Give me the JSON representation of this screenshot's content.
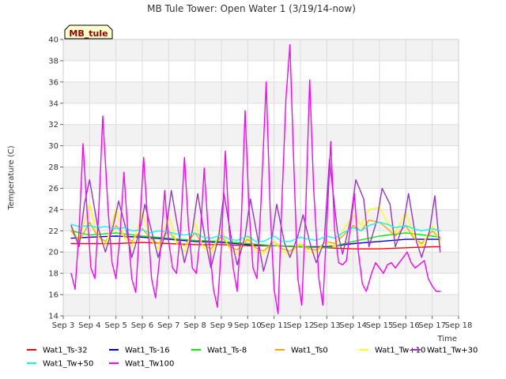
{
  "chart_data": {
    "type": "line",
    "title": "MB Tule Tower: Open Water 1 (3/19/14-now)",
    "badge": "MB_tule",
    "xlabel": "Time",
    "ylabel": "Temperature (C)",
    "xlim": [
      3,
      18
    ],
    "ylim": [
      14,
      40
    ],
    "x_tick_values": [
      3,
      4,
      5,
      6,
      7,
      8,
      9,
      10,
      11,
      12,
      13,
      14,
      15,
      16,
      17,
      18
    ],
    "x_tick_labels": [
      "Sep 3",
      "Sep 4",
      "Sep 5",
      "Sep 6",
      "Sep 7",
      "Sep 8",
      "Sep 9",
      "Sep 10",
      "Sep 11",
      "Sep 12",
      "Sep 13",
      "Sep 14",
      "Sep 15",
      "Sep 16",
      "Sep 17",
      "Sep 18"
    ],
    "y_ticks": [
      14,
      16,
      18,
      20,
      22,
      24,
      26,
      28,
      30,
      32,
      34,
      36,
      38,
      40
    ],
    "grid": true,
    "legend_position": "bottom",
    "series": [
      {
        "name": "Wat1_Ts-32",
        "color": "#ff0000",
        "x": [
          3.3,
          4,
          5,
          6,
          7,
          8,
          9,
          10,
          11,
          12,
          13,
          14,
          15,
          16,
          17,
          17.3
        ],
        "y": [
          20.8,
          20.8,
          20.8,
          20.9,
          20.8,
          20.7,
          20.7,
          20.6,
          20.6,
          20.5,
          20.4,
          20.3,
          20.3,
          20.4,
          20.5,
          20.5
        ]
      },
      {
        "name": "Wat1_Ts-16",
        "color": "#0000cc",
        "x": [
          3.3,
          4,
          5,
          6,
          7,
          8,
          9,
          10,
          11,
          12,
          13,
          14,
          15,
          16,
          17,
          17.3
        ],
        "y": [
          21.3,
          21.4,
          21.5,
          21.4,
          21.2,
          21.0,
          20.9,
          20.7,
          20.6,
          20.5,
          20.5,
          20.8,
          21.0,
          21.2,
          21.2,
          21.2
        ]
      },
      {
        "name": "Wat1_Ts-8",
        "color": "#00ee00",
        "x": [
          3.3,
          4,
          5,
          6,
          7,
          8,
          9,
          10,
          11,
          12,
          13,
          14,
          15,
          16,
          17,
          17.3
        ],
        "y": [
          22.0,
          21.6,
          21.8,
          21.5,
          21.3,
          21.1,
          21.0,
          20.8,
          20.6,
          20.5,
          20.4,
          21.0,
          21.5,
          21.8,
          21.5,
          21.4
        ]
      },
      {
        "name": "Wat1_Ts0",
        "color": "#ffa500",
        "x": [
          3.3,
          3.6,
          4.0,
          4.3,
          4.6,
          5.0,
          5.3,
          5.6,
          6.0,
          6.3,
          6.6,
          7.0,
          7.3,
          7.6,
          8.0,
          8.3,
          8.6,
          9.0,
          9.3,
          9.6,
          10.0,
          10.3,
          10.6,
          11.0,
          11.3,
          11.6,
          12.0,
          12.3,
          12.6,
          13.0,
          13.3,
          13.6,
          14.0,
          14.3,
          14.6,
          15.0,
          15.3,
          15.6,
          16.0,
          16.3,
          16.6,
          17.0,
          17.3
        ],
        "y": [
          22.0,
          21.0,
          22.8,
          21.5,
          21.0,
          22.5,
          21.6,
          21.0,
          22.2,
          21.3,
          20.8,
          22.0,
          21.0,
          20.6,
          21.8,
          20.7,
          20.3,
          21.5,
          20.5,
          20.2,
          21.2,
          20.4,
          20.1,
          21.0,
          20.3,
          20.1,
          20.8,
          20.3,
          20.2,
          21.0,
          20.8,
          21.5,
          22.5,
          22.0,
          23.0,
          22.8,
          22.2,
          21.5,
          22.5,
          21.3,
          20.8,
          22.0,
          21.2
        ]
      },
      {
        "name": "Wat1_Tw+10",
        "color": "#ffff00",
        "x": [
          3.3,
          3.6,
          4.0,
          4.3,
          4.6,
          5.0,
          5.3,
          5.6,
          6.0,
          6.3,
          6.6,
          7.0,
          7.3,
          7.6,
          8.0,
          8.3,
          8.6,
          9.0,
          9.3,
          9.6,
          10.0,
          10.3,
          10.6,
          11.0,
          11.3,
          11.6,
          12.0,
          12.3,
          12.6,
          13.0,
          13.3,
          13.6,
          14.0,
          14.3,
          14.6,
          15.0,
          15.3,
          15.6,
          16.0,
          16.3,
          16.6,
          17.0,
          17.3
        ],
        "y": [
          22.2,
          21.2,
          24.5,
          21.5,
          20.6,
          24.0,
          21.4,
          20.5,
          23.8,
          21.2,
          20.3,
          23.5,
          20.8,
          20.0,
          22.8,
          20.5,
          19.8,
          22.2,
          20.3,
          19.8,
          21.5,
          20.1,
          19.8,
          21.0,
          20.0,
          19.8,
          20.8,
          20.0,
          20.0,
          21.0,
          20.5,
          22.0,
          23.5,
          22.5,
          24.0,
          24.2,
          22.8,
          21.8,
          23.8,
          21.5,
          20.5,
          22.5,
          21.0
        ]
      },
      {
        "name": "Wat1_Tw+30",
        "color": "#9933cc",
        "x": [
          3.3,
          3.6,
          3.8,
          4.0,
          4.3,
          4.6,
          4.9,
          5.1,
          5.4,
          5.6,
          5.9,
          6.1,
          6.4,
          6.6,
          6.9,
          7.1,
          7.4,
          7.6,
          7.9,
          8.1,
          8.4,
          8.6,
          8.9,
          9.1,
          9.4,
          9.6,
          9.9,
          10.1,
          10.4,
          10.6,
          10.9,
          11.1,
          11.4,
          11.6,
          11.9,
          12.1,
          12.4,
          12.6,
          12.9,
          13.1,
          13.4,
          13.6,
          13.9,
          14.1,
          14.4,
          14.6,
          14.9,
          15.1,
          15.4,
          15.6,
          15.9,
          16.1,
          16.4,
          16.6,
          16.9,
          17.1,
          17.3
        ],
        "y": [
          22.5,
          20.5,
          24.5,
          26.8,
          22.5,
          20.0,
          22.5,
          24.8,
          22.0,
          19.5,
          22.0,
          24.5,
          21.5,
          19.5,
          22.0,
          25.8,
          21.5,
          19.0,
          22.0,
          25.5,
          21.0,
          18.5,
          21.5,
          25.5,
          21.0,
          18.8,
          21.5,
          25.0,
          21.0,
          18.2,
          21.0,
          24.5,
          20.8,
          19.5,
          21.5,
          23.5,
          20.5,
          19.0,
          21.0,
          28.7,
          22.0,
          19.8,
          23.0,
          26.8,
          25.0,
          20.5,
          23.0,
          26.0,
          24.5,
          20.5,
          22.5,
          25.5,
          21.0,
          19.5,
          22.0,
          25.3,
          20.0
        ]
      },
      {
        "name": "Wat1_Tw+50",
        "color": "#00ffff",
        "x": [
          3.3,
          3.6,
          4.0,
          4.3,
          4.6,
          5.0,
          5.3,
          5.6,
          6.0,
          6.3,
          6.6,
          7.0,
          7.3,
          7.6,
          8.0,
          8.3,
          8.6,
          9.0,
          9.3,
          9.6,
          10.0,
          10.3,
          10.6,
          11.0,
          11.3,
          11.6,
          12.0,
          12.3,
          12.6,
          13.0,
          13.3,
          13.6,
          14.0,
          14.3,
          14.6,
          15.0,
          15.3,
          15.6,
          16.0,
          16.3,
          16.6,
          17.0,
          17.3
        ],
        "y": [
          22.6,
          22.4,
          22.5,
          22.3,
          22.4,
          22.2,
          22.3,
          22.0,
          22.1,
          21.8,
          22.0,
          21.9,
          21.7,
          21.6,
          21.8,
          21.4,
          21.3,
          21.6,
          21.2,
          21.1,
          21.5,
          21.0,
          21.0,
          21.5,
          21.0,
          21.0,
          21.4,
          21.2,
          21.1,
          21.5,
          21.3,
          21.8,
          22.3,
          22.0,
          22.5,
          22.8,
          22.6,
          22.3,
          22.5,
          22.2,
          22.0,
          22.2,
          22.0
        ]
      },
      {
        "name": "Wat1_Tw100",
        "color": "#ff00ff",
        "x": [
          3.3,
          3.45,
          3.6,
          3.75,
          3.9,
          4.05,
          4.2,
          4.35,
          4.5,
          4.7,
          4.85,
          5.0,
          5.15,
          5.3,
          5.45,
          5.6,
          5.75,
          5.9,
          6.05,
          6.2,
          6.35,
          6.5,
          6.7,
          6.85,
          7.0,
          7.15,
          7.3,
          7.45,
          7.6,
          7.75,
          7.9,
          8.05,
          8.2,
          8.35,
          8.5,
          8.7,
          8.85,
          9.0,
          9.15,
          9.3,
          9.45,
          9.6,
          9.75,
          9.9,
          10.05,
          10.2,
          10.35,
          10.5,
          10.7,
          10.85,
          11.0,
          11.15,
          11.3,
          11.45,
          11.6,
          11.75,
          11.9,
          12.05,
          12.2,
          12.35,
          12.5,
          12.7,
          12.85,
          13.0,
          13.15,
          13.3,
          13.45,
          13.6,
          13.75,
          13.9,
          14.05,
          14.2,
          14.35,
          14.5,
          14.7,
          14.85,
          15.0,
          15.15,
          15.3,
          15.45,
          15.6,
          15.75,
          15.9,
          16.05,
          16.2,
          16.35,
          16.5,
          16.7,
          16.85,
          17.0,
          17.15,
          17.3
        ],
        "y": [
          18.0,
          16.5,
          22.0,
          30.2,
          24.0,
          18.5,
          17.5,
          24.0,
          32.8,
          24.0,
          19.0,
          17.5,
          21.5,
          27.5,
          22.0,
          17.5,
          16.2,
          22.5,
          28.9,
          23.0,
          17.5,
          15.7,
          20.5,
          25.8,
          21.0,
          18.5,
          18.0,
          22.0,
          28.9,
          22.5,
          18.5,
          18.0,
          21.5,
          27.9,
          22.0,
          16.5,
          14.8,
          20.5,
          29.5,
          22.0,
          18.5,
          16.3,
          22.5,
          33.3,
          24.0,
          18.5,
          17.5,
          24.5,
          36.0,
          24.0,
          16.5,
          14.2,
          25.0,
          34.5,
          39.5,
          28.0,
          17.5,
          15.0,
          24.0,
          36.2,
          26.0,
          17.5,
          15.0,
          22.5,
          30.4,
          22.0,
          19.0,
          18.8,
          19.2,
          22.5,
          25.5,
          20.0,
          17.0,
          16.3,
          18.0,
          19.0,
          18.5,
          18.0,
          18.8,
          19.0,
          18.5,
          19.0,
          19.5,
          20.0,
          19.0,
          18.5,
          18.8,
          19.2,
          17.5,
          16.8,
          16.3,
          16.3
        ]
      }
    ]
  }
}
